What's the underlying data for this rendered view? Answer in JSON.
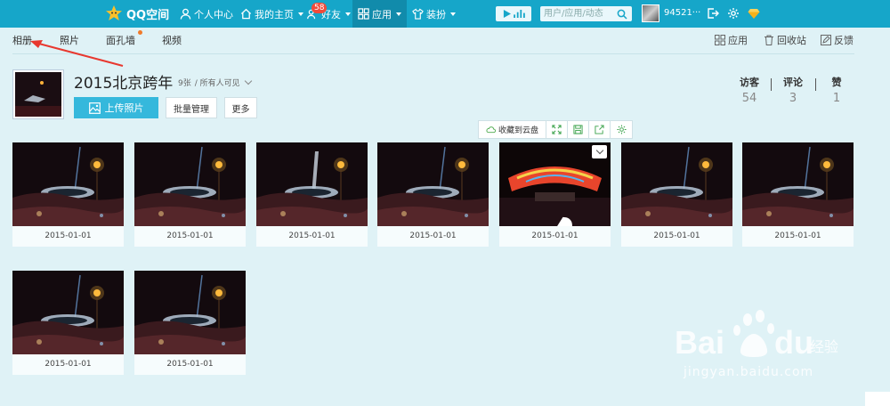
{
  "topbar": {
    "logo_text": "QQ空间",
    "nav": [
      {
        "label": "个人中心"
      },
      {
        "label": "我的主页"
      },
      {
        "label": "好友",
        "badge": "58"
      },
      {
        "label": "应用"
      },
      {
        "label": "装扮"
      }
    ],
    "search_placeholder": "用户/应用/动态",
    "username": "94521···",
    "colors": {
      "bar": "#16a6c9",
      "active": "#118bab",
      "badge": "#f04b3b"
    }
  },
  "subnav": {
    "tabs": [
      "相册",
      "照片",
      "面孔墙",
      "视频"
    ],
    "right": [
      "应用",
      "回收站",
      "反馈"
    ]
  },
  "album": {
    "title": "2015北京跨年",
    "count": "9张",
    "visibility": "/ 所有人可见",
    "upload_label": "上传照片",
    "batch_label": "批量管理",
    "more_label": "更多",
    "stats": [
      {
        "label": "访客",
        "value": "54"
      },
      {
        "label": "评论",
        "value": "3"
      },
      {
        "label": "赞",
        "value": "1"
      }
    ]
  },
  "photo_toolbar": {
    "save_cloud_label": "收藏到云盘"
  },
  "photos": [
    {
      "date": "2015-01-01"
    },
    {
      "date": "2015-01-01"
    },
    {
      "date": "2015-01-01"
    },
    {
      "date": "2015-01-01"
    },
    {
      "date": "2015-01-01"
    },
    {
      "date": "2015-01-01"
    },
    {
      "date": "2015-01-01"
    },
    {
      "date": "2015-01-01"
    },
    {
      "date": "2015-01-01"
    }
  ],
  "watermark": {
    "text": "jingyan.baidu.com"
  }
}
